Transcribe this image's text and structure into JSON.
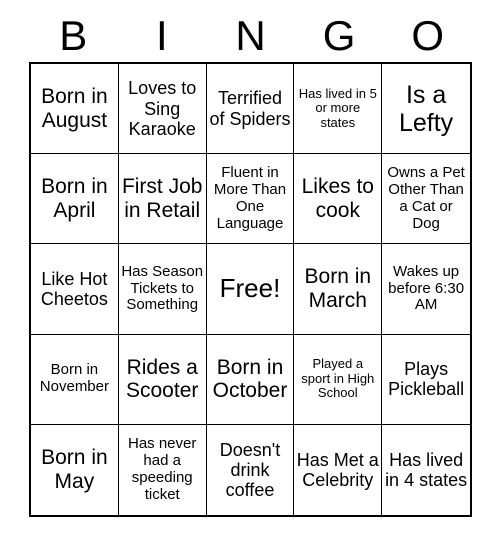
{
  "card": {
    "title": "BINGO",
    "header_letters": [
      "B",
      "I",
      "N",
      "G",
      "O"
    ],
    "free_space": "Free!",
    "colors": {
      "background": "#ffffff",
      "text": "#000000",
      "grid_line": "#000000"
    },
    "grid_size": "5x5",
    "columns": [
      "B",
      "I",
      "N",
      "G",
      "O"
    ],
    "cells": [
      {
        "row": 1,
        "col": 1,
        "text": "Born in August",
        "size": "lg"
      },
      {
        "row": 1,
        "col": 2,
        "text": "Loves to Sing Karaoke",
        "size": "md"
      },
      {
        "row": 1,
        "col": 3,
        "text": "Terrified of Spiders",
        "size": "md"
      },
      {
        "row": 1,
        "col": 4,
        "text": "Has lived in 5 or more states",
        "size": "xs"
      },
      {
        "row": 1,
        "col": 5,
        "text": "Is a Lefty",
        "size": "xl"
      },
      {
        "row": 2,
        "col": 1,
        "text": "Born in April",
        "size": "lg"
      },
      {
        "row": 2,
        "col": 2,
        "text": "First Job in Retail",
        "size": "lg"
      },
      {
        "row": 2,
        "col": 3,
        "text": "Fluent in More Than One Language",
        "size": "sm"
      },
      {
        "row": 2,
        "col": 4,
        "text": "Likes to cook",
        "size": "lg"
      },
      {
        "row": 2,
        "col": 5,
        "text": "Owns a Pet Other Than a Cat or Dog",
        "size": "sm"
      },
      {
        "row": 3,
        "col": 1,
        "text": "Like Hot Cheetos",
        "size": "md"
      },
      {
        "row": 3,
        "col": 2,
        "text": "Has Season Tickets to Something",
        "size": "sm"
      },
      {
        "row": 3,
        "col": 3,
        "text": "Free!",
        "size": "free"
      },
      {
        "row": 3,
        "col": 4,
        "text": "Born in March",
        "size": "lg"
      },
      {
        "row": 3,
        "col": 5,
        "text": "Wakes up before 6:30 AM",
        "size": "sm"
      },
      {
        "row": 4,
        "col": 1,
        "text": "Born in November",
        "size": "sm"
      },
      {
        "row": 4,
        "col": 2,
        "text": "Rides a Scooter",
        "size": "lg"
      },
      {
        "row": 4,
        "col": 3,
        "text": "Born in October",
        "size": "lg"
      },
      {
        "row": 4,
        "col": 4,
        "text": "Played a sport in High School",
        "size": "xs"
      },
      {
        "row": 4,
        "col": 5,
        "text": "Plays Pickleball",
        "size": "md"
      },
      {
        "row": 5,
        "col": 1,
        "text": "Born in May",
        "size": "lg"
      },
      {
        "row": 5,
        "col": 2,
        "text": "Has never had a speeding ticket",
        "size": "sm"
      },
      {
        "row": 5,
        "col": 3,
        "text": "Doesn't drink coffee",
        "size": "md"
      },
      {
        "row": 5,
        "col": 4,
        "text": "Has Met a Celebrity",
        "size": "md"
      },
      {
        "row": 5,
        "col": 5,
        "text": "Has lived in 4 states",
        "size": "md"
      }
    ]
  }
}
